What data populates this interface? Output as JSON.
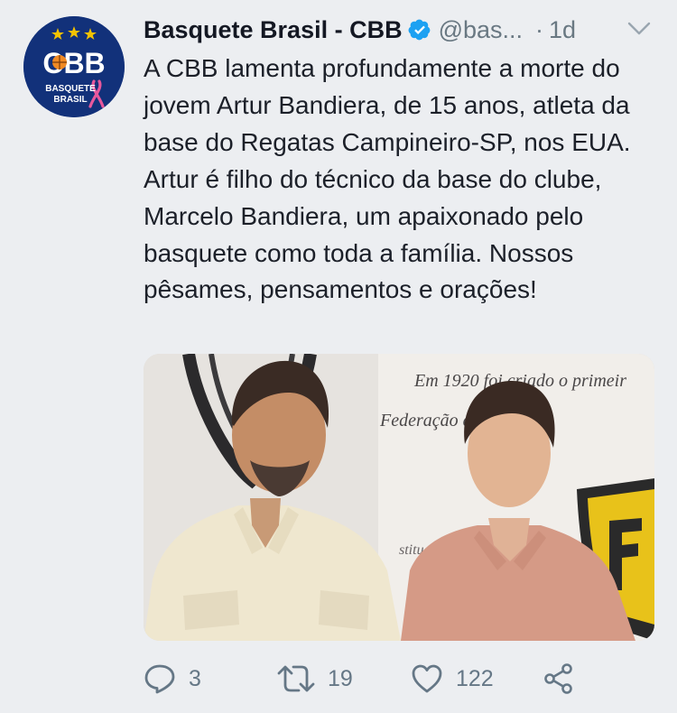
{
  "tweet": {
    "author_name": "Basquete Brasil - CBB",
    "author_handle": "@bas...",
    "separator": "·",
    "time": "1d",
    "avatar": {
      "text_logo": "CBB",
      "text_line1": "BASQUETE",
      "text_line2": "BRASIL",
      "brand_color": "#12317a",
      "ribbon_color": "#e8589c"
    },
    "text": "A CBB lamenta profundamente a morte do jovem Artur Bandiera, de 15 anos, atleta da base do Regatas Campineiro-SP, nos EUA. Artur é filho do técnico da base do clube, Marcelo Bandiera, um apaixonado pelo basquete como toda a família. Nossos pêsames, pensamentos e orações!",
    "media": {
      "wall_text_line1": "Em 1920 foi criado o primeir",
      "wall_text_line2": "Federação de Bola ao",
      "wall_text_line3": "stitu"
    },
    "actions": {
      "reply_icon": "reply-icon",
      "reply_count": "3",
      "retweet_icon": "retweet-icon",
      "retweet_count": "19",
      "like_icon": "heart-icon",
      "like_count": "122",
      "share_icon": "share-icon"
    },
    "colors": {
      "verified": "#1da1f2",
      "meta": "#697882"
    }
  }
}
